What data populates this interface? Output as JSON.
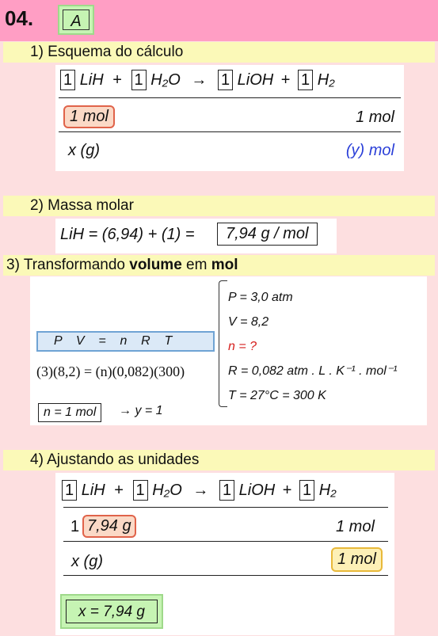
{
  "header": {
    "number": "04.",
    "answer": "A"
  },
  "step1": {
    "title": "1)  Esquema do cálculo",
    "coef": [
      "1",
      "1",
      "1",
      "1"
    ],
    "species": [
      "LiH",
      "H₂O",
      "LiOH",
      "H₂"
    ],
    "plus": "+",
    "arrow": "→",
    "row1_left": "1 mol",
    "row1_right": "1 mol",
    "row2_left": "x (g)",
    "row2_right": "(y) mol"
  },
  "step2": {
    "title": "2)  Massa molar",
    "formula_left": "LiH = (6,94) + (1) =",
    "result": "7,94 g / mol"
  },
  "step3": {
    "title_prefix": "3)  Transformando ",
    "title_bold1": "volume",
    "title_mid": " em ",
    "title_bold2": "mol",
    "equation": "P    V    =    n    R    T",
    "substitution": "(3)(8,2) = (n)(0,082)(300)",
    "result_box": "n = 1 mol",
    "result_tail": "→ y = 1",
    "givens": [
      "P = 3,0 atm",
      "V = 8,2",
      "n = ?",
      "R = 0,082 atm . L . K⁻¹ . mol⁻¹",
      "T = 27°C = 300 K"
    ]
  },
  "step4": {
    "title": "4)  Ajustando as unidades",
    "row1_coef": "1",
    "row1_left": "7,94 g",
    "row1_right": "1 mol",
    "row2_left": "x (g)",
    "row2_right": "1 mol",
    "answer": "x = 7,94 g"
  },
  "colors": {
    "header": "#ff9ec4",
    "band": "#fbf9b8",
    "background": "#fddfe0",
    "answer_green": "#c6f4b3",
    "red": "#d6211f",
    "blue": "#2a3fd8"
  }
}
